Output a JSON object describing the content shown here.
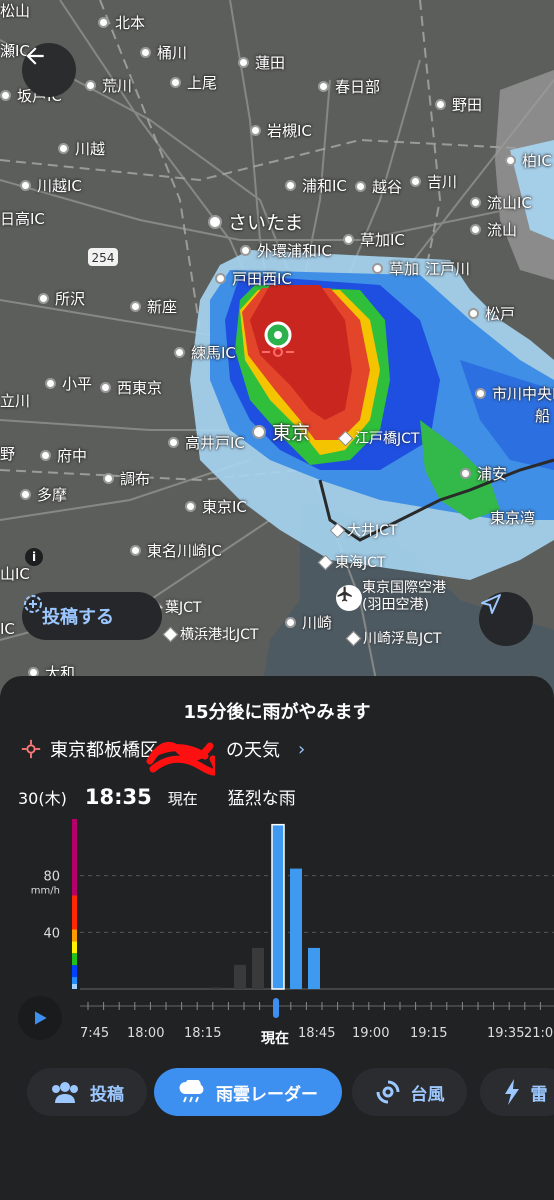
{
  "map": {
    "places": [
      {
        "name": "北本",
        "big": false
      },
      {
        "name": "桶川",
        "big": false
      },
      {
        "name": "荒川",
        "big": false
      },
      {
        "name": "上尾",
        "big": false
      },
      {
        "name": "蓮田",
        "big": false
      },
      {
        "name": "坂戸IC",
        "big": false
      },
      {
        "name": "春日部",
        "big": false
      },
      {
        "name": "野田",
        "big": false
      },
      {
        "name": "岩槻IC",
        "big": false
      },
      {
        "name": "川越",
        "big": false
      },
      {
        "name": "川越IC",
        "big": false
      },
      {
        "name": "浦和IC",
        "big": false
      },
      {
        "name": "越谷",
        "big": false
      },
      {
        "name": "吉川",
        "big": false
      },
      {
        "name": "流山IC",
        "big": false
      },
      {
        "name": "さいたま",
        "big": true
      },
      {
        "name": "草加IC",
        "big": false
      },
      {
        "name": "流山",
        "big": false
      },
      {
        "name": "外環浦和IC",
        "big": false
      },
      {
        "name": "草加",
        "big": false
      },
      {
        "name": "所沢",
        "big": false
      },
      {
        "name": "新座",
        "big": false
      },
      {
        "name": "松戸",
        "big": false
      },
      {
        "name": "練馬IC",
        "big": false
      },
      {
        "name": "小平",
        "big": false
      },
      {
        "name": "西東京",
        "big": false
      },
      {
        "name": "市川中央IC",
        "big": false
      },
      {
        "name": "高井戸IC",
        "big": false
      },
      {
        "name": "東京",
        "big": true
      },
      {
        "name": "府中",
        "big": false
      },
      {
        "name": "調布",
        "big": false
      },
      {
        "name": "浦安",
        "big": false
      },
      {
        "name": "多摩",
        "big": false
      },
      {
        "name": "東京IC",
        "big": false
      },
      {
        "name": "東名川崎IC",
        "big": false
      },
      {
        "name": "川崎",
        "big": false
      },
      {
        "name": "柏IC",
        "big": false
      },
      {
        "name": "戸田西IC",
        "big": false
      },
      {
        "name": "大和",
        "big": false
      },
      {
        "name": "東京湾",
        "big": false
      },
      {
        "name": "江戸川",
        "big": false
      }
    ],
    "jcts": [
      "江戸橋JCT",
      "大井JCT",
      "東海JCT",
      "葉JCT",
      "横浜港北JCT",
      "川崎浮島JCT"
    ],
    "airport": "東京国際空港\n(羽田空港)",
    "edge_labels": [
      "松山",
      "瀬IC",
      "日高IC",
      "立川",
      "野",
      "山IC",
      "IC",
      "船"
    ],
    "route_number": "254",
    "post_button": "投稿する"
  },
  "sheet": {
    "headline": "15分後に雨がやみます",
    "area": "東京都板橋区",
    "area_suffix": "の天気",
    "date": "30(木)",
    "time": "18:35",
    "now_label": "現在",
    "condition": "猛烈な雨"
  },
  "chart_data": {
    "type": "bar",
    "ylabel": "mm/h",
    "y_ticks": [
      40,
      80
    ],
    "ylim": [
      0,
      120
    ],
    "bars": [
      {
        "t": "18:00",
        "value": 0
      },
      {
        "t": "18:05",
        "value": 0
      },
      {
        "t": "18:10",
        "value": 0
      },
      {
        "t": "18:15",
        "value": 1
      },
      {
        "t": "18:20",
        "value": 17
      },
      {
        "t": "18:25",
        "value": 29
      },
      {
        "t": "18:30",
        "value": 0
      },
      {
        "t": "18:35",
        "value": 116,
        "current": true
      },
      {
        "t": "18:40",
        "value": 85
      },
      {
        "t": "18:45",
        "value": 29
      }
    ],
    "x_ticks": [
      "7:45",
      "18:00",
      "18:15",
      "現在",
      "18:45",
      "19:00",
      "19:15",
      "19:35",
      "21:0"
    ],
    "scale_colors": [
      "#b40068",
      "#ff2800",
      "#ff9900",
      "#fff200",
      "#21c21b",
      "#0041ff",
      "#218cff",
      "#a0d2ff"
    ]
  },
  "tabs": [
    {
      "label": "投稿",
      "icon": "people-icon",
      "active": false
    },
    {
      "label": "雨雲レーダー",
      "icon": "rain-cloud-icon",
      "active": true
    },
    {
      "label": "台風",
      "icon": "typhoon-icon",
      "active": false
    },
    {
      "label": "雷",
      "icon": "lightning-icon",
      "active": false
    }
  ]
}
